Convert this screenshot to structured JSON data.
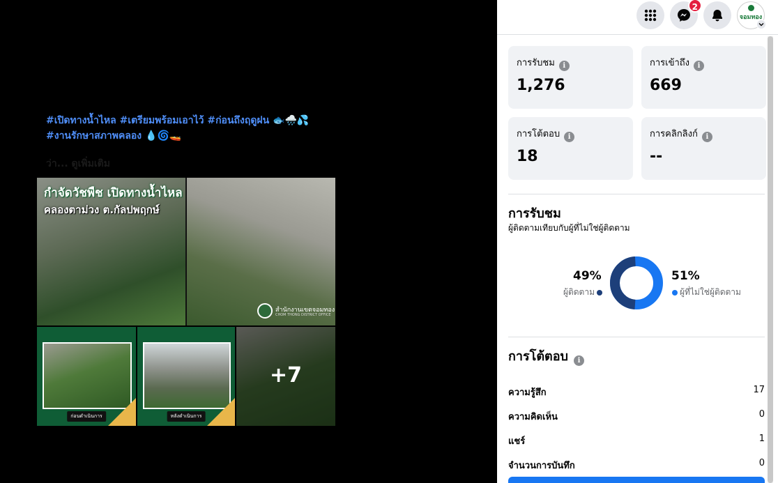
{
  "post": {
    "caption_line1": "#เปิดทางน้ำไหล #เตรียมพร้อมเอาไว้ #ก่อนถึงฤดูฝน 🐟🌧️💦",
    "caption_line2": "#งานรักษาสภาพคลอง 💧🌀🚤",
    "see_more": "ว่า... ดูเพิ่มเติม",
    "photo_title": "กำจัดวัชพืช เปิดทางน้ำไหล",
    "photo_subtitle": "คลองตาม่วง  ต.กัลปพฤกษ์",
    "photo_office": "สำนักงานเขตจอมทอง",
    "photo_office_en": "CHOM THONG DISTRICT OFFICE",
    "thumb1_tag": "ก่อนดำเนินการ",
    "thumb2_tag": "หลังดำเนินการ",
    "more_photos": "+7"
  },
  "topbar": {
    "menu_icon": "grid-menu-icon",
    "messenger_icon": "messenger-icon",
    "messenger_badge": "2",
    "notifications_icon": "bell-icon",
    "account_name": "จอมทอง"
  },
  "stats": {
    "views_label": "การรับชม",
    "views_value": "1,276",
    "reach_label": "การเข้าถึง",
    "reach_value": "669",
    "engagement_label": "การโต้ตอบ",
    "engagement_value": "18",
    "clicks_label": "การคลิกลิงก์",
    "clicks_value": "--",
    "info_glyph": "i"
  },
  "views_section": {
    "title": "การรับชม",
    "subtitle": "ผู้ติดตามเทียบกับผู้ที่ไม่ใช่ผู้ติดตาม",
    "followers_pct": "49%",
    "followers_label": "ผู้ติดตาม",
    "non_followers_pct": "51%",
    "non_followers_label": "ผู้ที่ไม่ใช่ผู้ติดตาม",
    "followers_share": 0.49,
    "followers_color": "#1d3f7a",
    "non_followers_color": "#1877f2"
  },
  "engagement_section": {
    "title": "การโต้ตอบ",
    "rows": [
      {
        "label": "ความรู้สึก",
        "value": "17"
      },
      {
        "label": "ความคิดเห็น",
        "value": "0"
      },
      {
        "label": "แชร์",
        "value": "1"
      },
      {
        "label": "จำนวนการบันทึก",
        "value": "0"
      }
    ]
  },
  "colors": {
    "accent": "#1877f2",
    "hashtag": "#4f8ef7",
    "card_bg": "#f0f2f5"
  }
}
